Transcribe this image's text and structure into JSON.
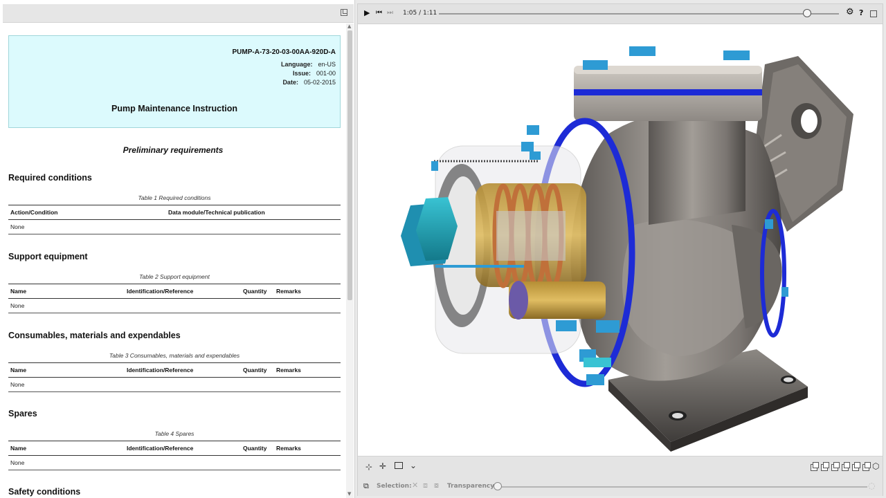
{
  "document": {
    "dmc": "PUMP-A-73-20-03-00AA-920D-A",
    "language_label": "Language:",
    "language_value": "en-US",
    "issue_label": "Issue:",
    "issue_value": "001-00",
    "date_label": "Date:",
    "date_value": "05-02-2015",
    "title": "Pump Maintenance Instruction",
    "prelim_heading": "Preliminary requirements",
    "sections": [
      {
        "heading": "Required conditions",
        "caption": "Table 1 Required conditions",
        "columns": [
          "Action/Condition",
          "Data module/Technical publication"
        ],
        "rows": [
          [
            "None"
          ]
        ]
      },
      {
        "heading": "Support equipment",
        "caption": "Table 2 Support equipment",
        "columns": [
          "Name",
          "Identification/Reference",
          "Quantity",
          "Remarks"
        ],
        "rows": [
          [
            "None"
          ]
        ]
      },
      {
        "heading": "Consumables, materials and expendables",
        "caption": "Table 3 Consumables, materials and expendables",
        "columns": [
          "Name",
          "Identification/Reference",
          "Quantity",
          "Remarks"
        ],
        "rows": [
          [
            "None"
          ]
        ]
      },
      {
        "heading": "Spares",
        "caption": "Table 4 Spares",
        "columns": [
          "Name",
          "Identification/Reference",
          "Quantity",
          "Remarks"
        ],
        "rows": [
          [
            "None"
          ]
        ]
      },
      {
        "heading": "Safety conditions"
      }
    ]
  },
  "player": {
    "current_time": "1:05",
    "separator": "/",
    "total_time": "1:11",
    "progress": 0.92
  },
  "bottom_toolbar": {
    "selection_label": "Selection:",
    "transparency_label": "Transparency:",
    "transparency_value": 0
  },
  "colors": {
    "id_box_bg": "#dcfafd",
    "gasket_blue": "#1d2bd6",
    "bolt_cyan": "#2e9bd4",
    "spring_copper": "#c0703a",
    "housing_gray": "#8a8580"
  },
  "icons": [
    "expand-icon",
    "play-icon",
    "skip-back-icon",
    "skip-forward-icon",
    "settings-gear-icon",
    "help-icon",
    "fullscreen-icon",
    "rotate-icon",
    "pan-icon",
    "zoom-box-icon",
    "fit-icon",
    "view-cube-icon"
  ]
}
